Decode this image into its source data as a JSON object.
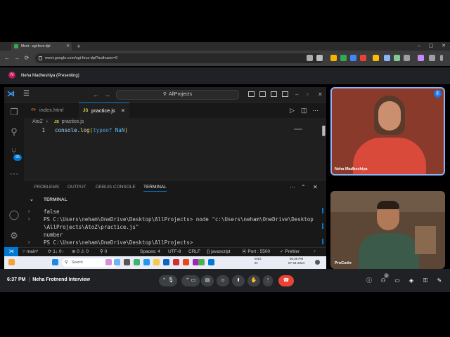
{
  "browser": {
    "tab_title": "Meet - sgt-fevz-dpt",
    "url": "meet.google.com/sgt-fevz-dpt?authuser=0",
    "new_tab": "+",
    "back": "←",
    "forward": "→",
    "reload": "⟳"
  },
  "meet": {
    "presenter_initial": "N",
    "presenter_label": "Neha Madheshiya (Presenting)",
    "time": "6:37 PM",
    "meeting_title": "Neha Frotnend Interview",
    "participants": [
      {
        "name": "Neha Madheshiya"
      },
      {
        "name": "ProCodrr"
      }
    ],
    "people_count": "3"
  },
  "vscode": {
    "search": "AllProjects",
    "tabs": [
      {
        "icon": "JS",
        "label": "index.html"
      },
      {
        "icon": "JS",
        "label": "practice.js",
        "close": "✕"
      }
    ],
    "breadcrumb": {
      "folder": "AtoZ",
      "sep": "›",
      "icon": "JS",
      "file": "practice.js"
    },
    "editor": {
      "line_number": "1",
      "code": {
        "obj": "console",
        "dot": ".",
        "fn": "log",
        "open": "(",
        "kw": "typeof",
        "space": " ",
        "val": "NaN",
        "close": ")"
      }
    },
    "activity_badge": "55",
    "panel_tabs": [
      "PROBLEMS",
      "OUTPUT",
      "DEBUG CONSOLE",
      "TERMINAL"
    ],
    "terminal_header": "TERMINAL",
    "terminal_lines": [
      "false",
      "PS C:\\Users\\neham\\OneDrive\\Desktop\\AllProjects> node \"c:\\Users\\neham\\OneDrive\\Desktop",
      "\\AllProjects\\AtoZ\\practice.js\"",
      "number",
      "PS C:\\Users\\neham\\OneDrive\\Desktop\\AllProjects>"
    ],
    "status": {
      "branch": "main*",
      "sync": "1↓ 0↑",
      "errors": "0",
      "warnings": "0",
      "ports": "0",
      "spaces": "Spaces: 4",
      "encoding": "UTF-8",
      "eol": "CRLF",
      "language": "javascript",
      "port": "Port : 5500",
      "prettier": "Prettier"
    }
  },
  "windows": {
    "search": "Search",
    "lang": "ENG",
    "region": "IN",
    "time": "06:36 PM",
    "date": "07-04-2024"
  }
}
